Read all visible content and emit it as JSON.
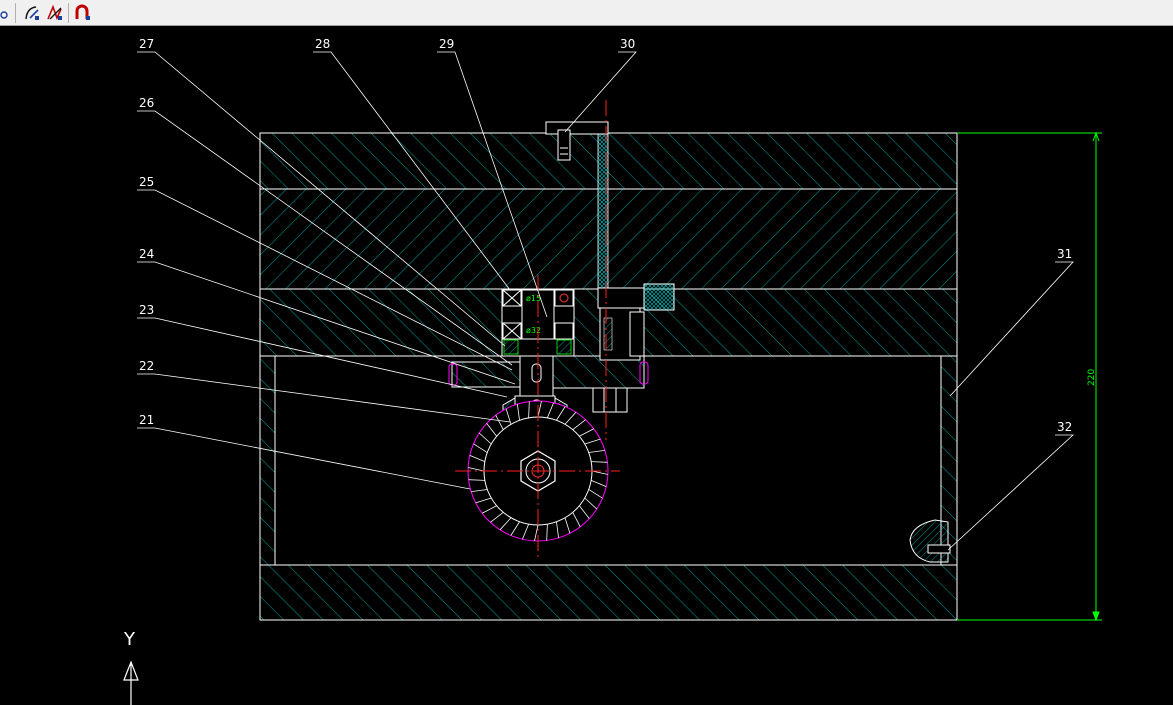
{
  "toolbar": {
    "buttons": [
      {
        "name": "snap-point-icon"
      },
      {
        "name": "draw-arc-icon"
      },
      {
        "name": "edit-polyline-icon"
      },
      {
        "name": "magnet-snap-icon"
      }
    ]
  },
  "drawing": {
    "part_labels": [
      "21",
      "22",
      "23",
      "24",
      "25",
      "26",
      "27",
      "28",
      "29",
      "30",
      "31",
      "32"
    ],
    "dimension": "220",
    "bearing_dims": [
      "ø15",
      "ø32"
    ],
    "ucs_axis_label": "Y"
  },
  "colors": {
    "outline": "#ffffff",
    "hatch": "#00c8c8",
    "dimension": "#00ff00",
    "centerline": "#ff0000",
    "gear_edge": "#ff00ff"
  }
}
